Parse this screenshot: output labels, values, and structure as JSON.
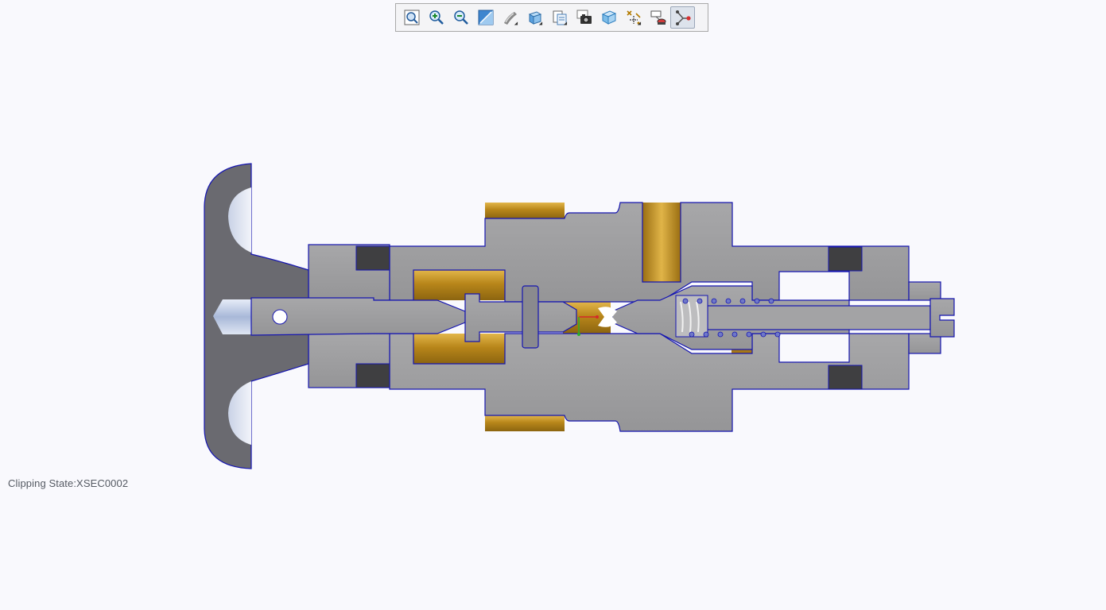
{
  "toolbar": {
    "buttons": [
      {
        "name": "refit",
        "icon": "zoom-fit-icon"
      },
      {
        "name": "zoom-in",
        "icon": "zoom-in-icon"
      },
      {
        "name": "zoom-out",
        "icon": "zoom-out-icon"
      },
      {
        "name": "repaint",
        "icon": "repaint-icon"
      },
      {
        "name": "display-style",
        "icon": "shaded-display-icon",
        "has_dropdown": true
      },
      {
        "name": "saved-orientations",
        "icon": "view-cube-icon",
        "has_dropdown": true
      },
      {
        "name": "view-manager",
        "icon": "view-manager-icon",
        "has_dropdown": true
      },
      {
        "name": "screenshot",
        "icon": "camera-icon"
      },
      {
        "name": "perspective",
        "icon": "perspective-box-icon"
      },
      {
        "name": "datum-display",
        "icon": "datum-display-icon",
        "has_dropdown": true
      },
      {
        "name": "annotation-display",
        "icon": "annotation-display-icon"
      },
      {
        "name": "spin-center",
        "icon": "spin-center-icon",
        "active": true
      }
    ]
  },
  "colors": {
    "background": "#f9f9fd",
    "section_gray": "#9b9b9b",
    "edge_blue": "#1515b0",
    "brass": "#c49a2c",
    "seal_dark": "#3f3f41",
    "handle_dark": "#6a6a70"
  },
  "status": {
    "clipping_state": "Clipping State:XSEC0002"
  }
}
